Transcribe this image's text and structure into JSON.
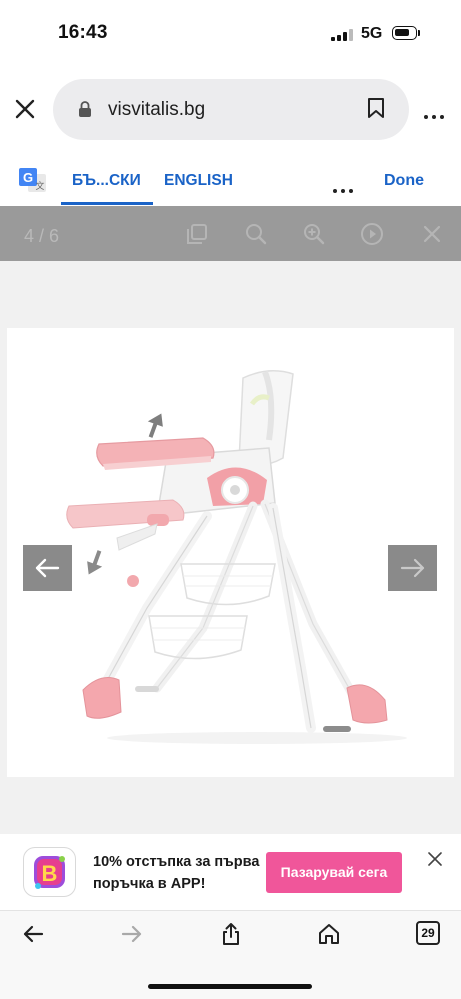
{
  "status_bar": {
    "time": "16:43",
    "network": "5G",
    "icons": [
      "signal-icon",
      "battery-icon"
    ]
  },
  "browser": {
    "url": "visvitalis.bg",
    "icons": [
      "close-icon",
      "lock-icon",
      "bookmark-icon",
      "more-icon"
    ]
  },
  "translate_bar": {
    "icon": "google-translate-icon",
    "source_lang": "БЪ...СКИ",
    "target_lang": "ENGLISH",
    "done_label": "Done",
    "selected": "source"
  },
  "gallery": {
    "counter": "4 / 6",
    "tools": [
      "fullscreen-icon",
      "zoom-out-icon",
      "zoom-in-icon",
      "play-icon",
      "close-icon"
    ],
    "product": "pink-high-chair",
    "colors": {
      "toolbar": "#9a9a9a",
      "arrow_button": "#8a8a8a",
      "chair_accent": "#f4a7ad"
    }
  },
  "banner": {
    "text": "10% отстъпка за първа поръчка в APP!",
    "button_label": "Пазарувай сега",
    "button_color": "#f0569a",
    "logo": "app-logo-b"
  },
  "bottom_bar": {
    "tabs_count": "29",
    "icons": [
      "back-icon",
      "forward-icon",
      "share-icon",
      "home-icon",
      "tabs-icon"
    ]
  }
}
